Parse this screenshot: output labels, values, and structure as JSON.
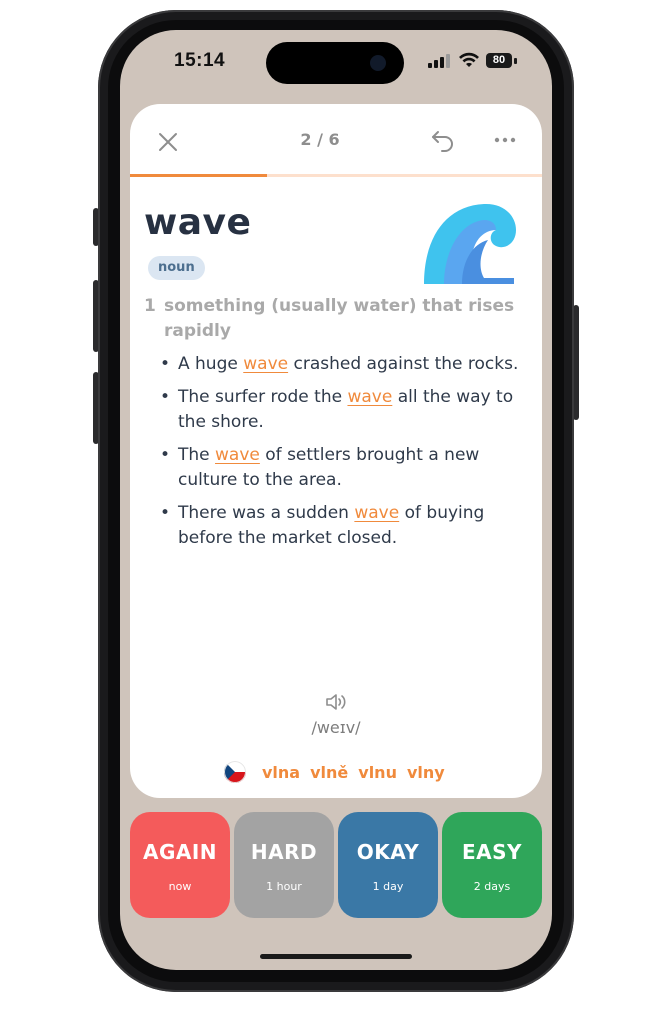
{
  "status_bar": {
    "time": "15:14",
    "battery": "80"
  },
  "topbar": {
    "counter": "2 / 6"
  },
  "progress": {
    "fraction": 0.333
  },
  "card": {
    "word": "wave",
    "part_of_speech": "noun",
    "definition_number": "1",
    "definition": "something (usually water) that rises rapidly",
    "examples": [
      {
        "before": "A huge ",
        "highlight": "wave",
        "after": " crashed against the rocks."
      },
      {
        "before": "The surfer rode the ",
        "highlight": "wave",
        "after": " all the way to the shore."
      },
      {
        "before": "The ",
        "highlight": "wave",
        "after": " of settlers brought a new culture to the area."
      },
      {
        "before": "There was a sudden ",
        "highlight": "wave",
        "after": " of buying before the market closed."
      }
    ],
    "pronunciation": "/weɪv/",
    "translations": [
      "vlna",
      "vlně",
      "vlnu",
      "vlny"
    ]
  },
  "answers": [
    {
      "label": "AGAIN",
      "interval": "now"
    },
    {
      "label": "HARD",
      "interval": "1 hour"
    },
    {
      "label": "OKAY",
      "interval": "1 day"
    },
    {
      "label": "EASY",
      "interval": "2 days"
    }
  ],
  "colors": {
    "accent": "#f08a3c",
    "again": "#f45b5b",
    "hard": "#a3a3a3",
    "okay": "#3a78a6",
    "easy": "#2fa65a",
    "background": "#cfc4bb"
  },
  "icons": {
    "close": "close-icon",
    "undo": "undo-icon",
    "more": "more-icon",
    "speaker": "speaker-icon",
    "flag": "czech-flag-icon",
    "illustration": "wave-illustration"
  }
}
